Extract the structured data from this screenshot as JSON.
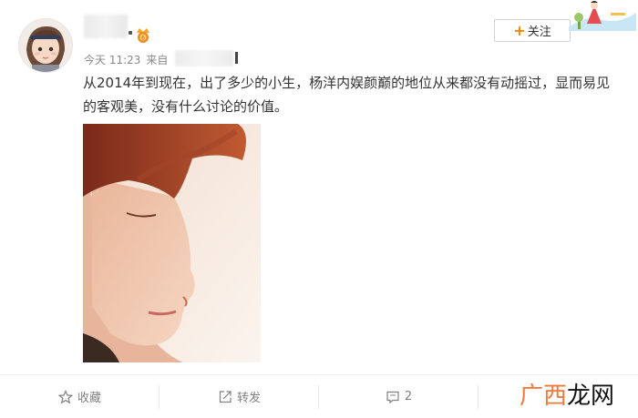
{
  "post": {
    "meta": {
      "time": "今天 11:23",
      "source_prefix": "来自"
    },
    "follow_label": "关注",
    "text": "从2014年到现在，出了多少的小生，杨洋内娱颜巅的地位从来都没有动摇过，显而易见的客观美，没有什么讨论的价值。"
  },
  "actions": {
    "favorite_label": "收藏",
    "repost_label": "转发",
    "comment_count": "2"
  },
  "watermark": {
    "part1": "广西",
    "part2": "龙网"
  },
  "colors": {
    "accent": "#ff8200",
    "muted": "#808080",
    "watermark": "#f07a3a"
  },
  "icons": [
    "star-icon",
    "repost-icon",
    "comment-icon",
    "vip-badge-icon"
  ]
}
